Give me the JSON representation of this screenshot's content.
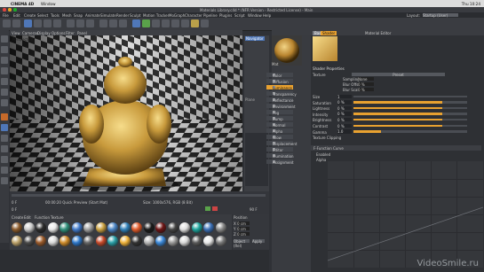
{
  "macos_menubar": {
    "app_name": "CINEMA 4D",
    "menus": [
      "Window"
    ],
    "clock": "Thu 10:24"
  },
  "window": {
    "title": "Materials Library.c4d * (NFR Version - Restricted License) - Main"
  },
  "c4d_menu": [
    "File",
    "Edit",
    "Create",
    "Select",
    "Tools",
    "Mesh",
    "Snap",
    "Animate",
    "Simulate",
    "Render",
    "Sculpt",
    "Motion Tracker",
    "MoGraph",
    "Character",
    "Pipeline",
    "Plugins",
    "Script",
    "Window",
    "Help"
  ],
  "layout": {
    "label": "Layout:",
    "value": "Startup (User)"
  },
  "viewport": {
    "label": "Perspective",
    "menus": [
      "View",
      "Cameras",
      "Display",
      "Options",
      "Filter",
      "Panel"
    ]
  },
  "object_panel": {
    "tabs": [
      "Navigator",
      "Plane"
    ]
  },
  "timeline": {
    "frame_start": "0 F",
    "frame_end": "90 F",
    "current": "0 F",
    "render_info": "00:00:20  Quick Preview (Start Mat)",
    "size_info": "Size: 1000x576, RGB (8 Bit)"
  },
  "material_panel": {
    "menus": [
      "Create",
      "Edit",
      "Function",
      "Texture"
    ],
    "swatch_colors": [
      "#8a5a2b",
      "#c9c9c9",
      "#2b2b2b",
      "#e8e8e8",
      "#2f8f7a",
      "#3f78c8",
      "#a0a0a0",
      "#c9a040",
      "#4a84c4",
      "#2f7fb7",
      "#e05a2a",
      "#1a1a1a",
      "#6e1414",
      "#444444",
      "#dfdfdf",
      "#1ca39c",
      "#3a6fb6",
      "#888888",
      "#bda36b",
      "#4a4a4a",
      "#9a5a2a",
      "#d8d8d8",
      "#cf8c2a",
      "#2d77c9",
      "#666666",
      "#c74a2a",
      "#2a9fa8",
      "#efb23a",
      "#333333",
      "#b5b5b5",
      "#3b88d8",
      "#999999",
      "#d9d9d9",
      "#5a5a5a",
      "#e9e9e9",
      "#7a7a7a",
      "#aaaaaa",
      "#2a2a2a",
      "#cccccc",
      "#555555"
    ]
  },
  "coords_panel": {
    "labels": [
      "Position",
      "Size",
      "Rotation"
    ],
    "rows": [
      {
        "axis": "X",
        "value": "0 cm"
      },
      {
        "axis": "Y",
        "value": "0 cm"
      },
      {
        "axis": "Z",
        "value": "0 cm"
      }
    ],
    "mode": "Object (Rel)",
    "apply_label": "Apply"
  },
  "material_editor": {
    "title": "Material Editor",
    "tabs": [
      "Basic",
      "Shader"
    ],
    "material_name": "Mat",
    "channels": [
      "Color",
      "Diffusion",
      "Luminance",
      "Transparency",
      "Reflectance",
      "Environment",
      "Fog",
      "Bump",
      "Normal",
      "Alpha",
      "Glow",
      "Displacement",
      "Editor",
      "Illumination",
      "Assignment"
    ],
    "section_title": "Shader Properties",
    "texture_label": "Texture",
    "preview_label": "Preset",
    "preset_rows": [
      {
        "label": "Sampling",
        "value": "None"
      },
      {
        "label": "Blur Offset",
        "value": "0 %"
      },
      {
        "label": "Blur Scale",
        "value": "0 %"
      }
    ],
    "properties": [
      {
        "label": "Size",
        "value": "1",
        "fill": 0.0
      },
      {
        "label": "Saturation",
        "value": "0 %",
        "fill": 0.78
      },
      {
        "label": "Lightness",
        "value": "0 %",
        "fill": 0.78
      },
      {
        "label": "Intensity",
        "value": "0 %",
        "fill": 0.78
      },
      {
        "label": "Brightness",
        "value": "0 %",
        "fill": 0.78
      },
      {
        "label": "Contrast",
        "value": "0 %",
        "fill": 0.78
      },
      {
        "label": "Gamma",
        "value": "1.0",
        "fill": 0.24
      },
      {
        "label": "Texture Clipping",
        "value": "",
        "fill": 0.0
      }
    ],
    "curve_section": "F-Function Curve",
    "curve_options": [
      "Enabled",
      "Alpha"
    ]
  },
  "watermark": "VideoSmile.ru"
}
